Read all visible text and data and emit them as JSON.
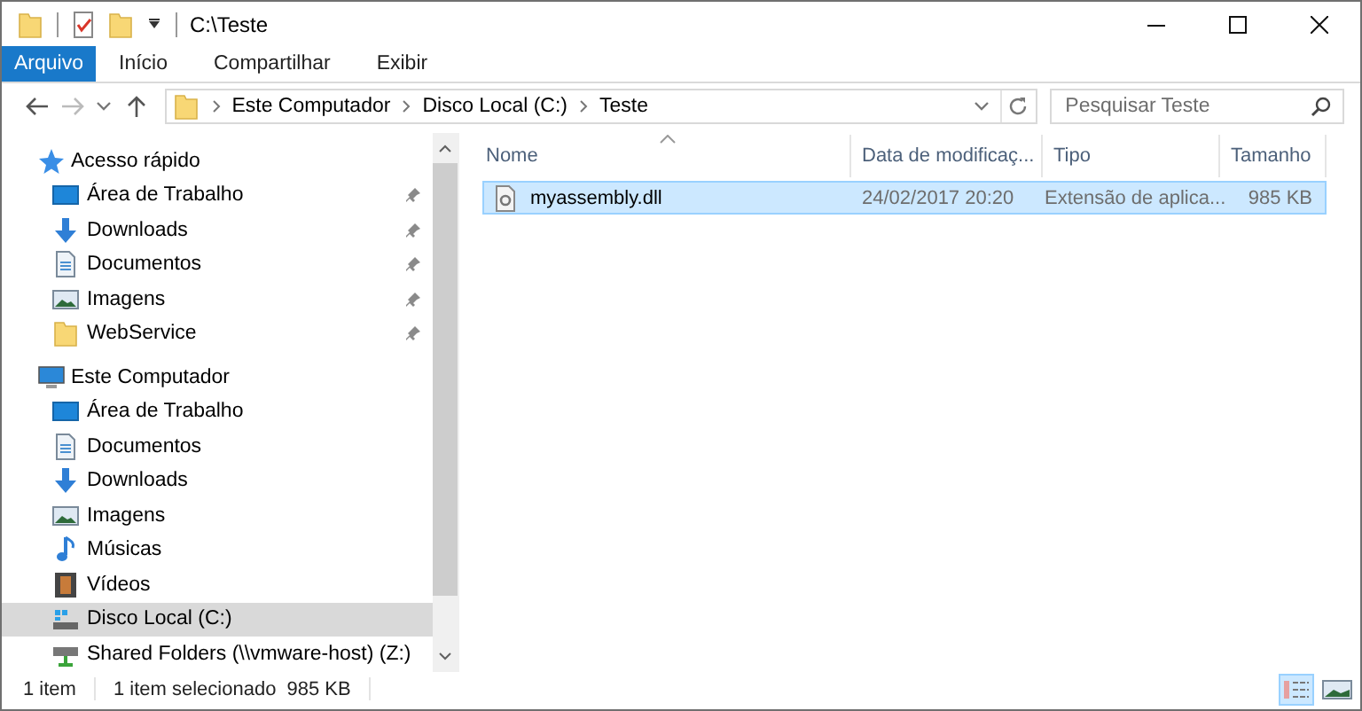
{
  "window": {
    "title": "C:\\Teste"
  },
  "ribbon_tabs": [
    {
      "label": "Arquivo",
      "kind": "file"
    },
    {
      "label": "Início",
      "kind": "tab"
    },
    {
      "label": "Compartilhar",
      "kind": "tab"
    },
    {
      "label": "Exibir",
      "kind": "tab"
    }
  ],
  "address": {
    "segments": [
      "Este Computador",
      "Disco Local (C:)",
      "Teste"
    ]
  },
  "search": {
    "placeholder": "Pesquisar Teste"
  },
  "nav": [
    {
      "label": "Acesso rápido",
      "kind": "star",
      "selected": false,
      "children": [
        {
          "label": "Área de Trabalho",
          "kind": "desktop",
          "pinned": true,
          "selected": false
        },
        {
          "label": "Downloads",
          "kind": "download",
          "pinned": true,
          "selected": false
        },
        {
          "label": "Documentos",
          "kind": "documents",
          "pinned": true,
          "selected": false
        },
        {
          "label": "Imagens",
          "kind": "pictures",
          "pinned": true,
          "selected": false
        },
        {
          "label": "WebService",
          "kind": "folder",
          "pinned": true,
          "selected": false
        }
      ]
    },
    {
      "label": "Este Computador",
      "kind": "computer",
      "selected": false,
      "children": [
        {
          "label": "Área de Trabalho",
          "kind": "desktop",
          "pinned": false,
          "selected": false
        },
        {
          "label": "Documentos",
          "kind": "documents",
          "pinned": false,
          "selected": false
        },
        {
          "label": "Downloads",
          "kind": "download",
          "pinned": false,
          "selected": false
        },
        {
          "label": "Imagens",
          "kind": "pictures",
          "pinned": false,
          "selected": false
        },
        {
          "label": "Músicas",
          "kind": "music",
          "pinned": false,
          "selected": false
        },
        {
          "label": "Vídeos",
          "kind": "videos",
          "pinned": false,
          "selected": false
        },
        {
          "label": "Disco Local (C:)",
          "kind": "drive",
          "pinned": false,
          "selected": true
        },
        {
          "label": "Shared Folders (\\\\vmware-host) (Z:)",
          "kind": "network-drive",
          "pinned": false,
          "selected": false
        }
      ]
    }
  ],
  "columns": [
    {
      "label": "Nome",
      "sorted": true
    },
    {
      "label": "Data de modificaç...",
      "sorted": false
    },
    {
      "label": "Tipo",
      "sorted": false
    },
    {
      "label": "Tamanho",
      "sorted": false
    }
  ],
  "rows": [
    {
      "name": "myassembly.dll",
      "date": "24/02/2017 20:20",
      "type": "Extensão de aplica...",
      "size": "985 KB",
      "selected": true
    }
  ],
  "status_bar": {
    "count": "1 item",
    "selection": "1 item selecionado",
    "size": "985 KB"
  },
  "view_buttons": [
    {
      "kind": "details",
      "selected": true
    },
    {
      "kind": "tiles",
      "selected": false
    }
  ]
}
